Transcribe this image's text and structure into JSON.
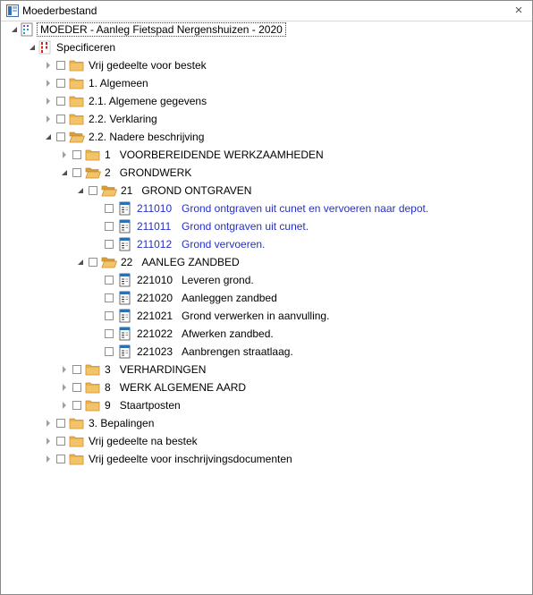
{
  "window": {
    "title": "Moederbestand",
    "close_glyph": "×"
  },
  "tree": {
    "root": {
      "label": "MOEDER - Aanleg Fietspad Nergenshuizen - 2020"
    },
    "spec": {
      "label": "Specificeren"
    },
    "items": [
      {
        "id": "vrij-voor-bestek",
        "label": "Vrij gedeelte voor bestek"
      },
      {
        "id": "algemeen",
        "label": "1. Algemeen"
      },
      {
        "id": "algemene-gegevens",
        "label": "2.1. Algemene gegevens"
      },
      {
        "id": "verklaring",
        "label": "2.2. Verklaring"
      },
      {
        "id": "nadere-beschrijving",
        "label": "2.2. Nadere beschrijving"
      },
      {
        "id": "voorbereidende",
        "num": "1",
        "label": "VOORBEREIDENDE WERKZAAMHEDEN"
      },
      {
        "id": "grondwerk",
        "num": "2",
        "label": "GRONDWERK"
      },
      {
        "id": "grond-ontgraven",
        "num": "21",
        "label": "GROND ONTGRAVEN"
      },
      {
        "id": "211010",
        "code": "211010",
        "label": "Grond ontgraven uit cunet en vervoeren naar depot."
      },
      {
        "id": "211011",
        "code": "211011",
        "label": "Grond ontgraven uit cunet."
      },
      {
        "id": "211012",
        "code": "211012",
        "label": "Grond vervoeren."
      },
      {
        "id": "aanleg-zandbed",
        "num": "22",
        "label": "AANLEG ZANDBED"
      },
      {
        "id": "221010",
        "code": "221010",
        "label": "Leveren grond."
      },
      {
        "id": "221020",
        "code": "221020",
        "label": "Aanleggen zandbed"
      },
      {
        "id": "221021",
        "code": "221021",
        "label": "Grond verwerken in aanvulling."
      },
      {
        "id": "221022",
        "code": "221022",
        "label": "Afwerken zandbed."
      },
      {
        "id": "221023",
        "code": "221023",
        "label": "Aanbrengen straatlaag."
      },
      {
        "id": "verhardingen",
        "num": "3",
        "label": "VERHARDINGEN"
      },
      {
        "id": "werk-algemene-aard",
        "num": "8",
        "label": "WERK ALGEMENE AARD"
      },
      {
        "id": "staartposten",
        "num": "9",
        "label": "Staartposten"
      },
      {
        "id": "bepalingen",
        "label": "3. Bepalingen"
      },
      {
        "id": "vrij-na-bestek",
        "label": "Vrij gedeelte na bestek"
      },
      {
        "id": "vrij-inschrijving",
        "label": "Vrij gedeelte voor inschrijvingsdocumenten"
      }
    ]
  },
  "colors": {
    "folder": "#e8b04f",
    "link_blue": "#2430c8",
    "spec_red": "#d62020"
  }
}
